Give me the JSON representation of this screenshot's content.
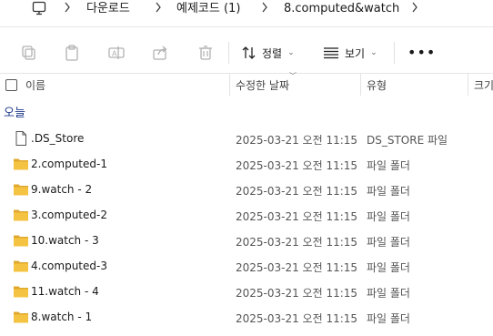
{
  "breadcrumb": {
    "items": [
      "다운로드",
      "예제코드 (1)",
      "8.computed&watch"
    ]
  },
  "toolbar": {
    "sort_label": "정렬",
    "view_label": "보기",
    "more_label": "•••"
  },
  "columns": {
    "name": "이름",
    "modified": "수정한 날짜",
    "type": "유형",
    "size": "크기"
  },
  "group": {
    "label": "오늘"
  },
  "files": [
    {
      "name": ".DS_Store",
      "modified": "2025-03-21 오전 11:15",
      "type": "DS_STORE 파일",
      "icon": "file-icon"
    },
    {
      "name": "2.computed-1",
      "modified": "2025-03-21 오전 11:15",
      "type": "파일 폴더",
      "icon": "folder-icon"
    },
    {
      "name": "9.watch - 2",
      "modified": "2025-03-21 오전 11:15",
      "type": "파일 폴더",
      "icon": "folder-icon"
    },
    {
      "name": "3.computed-2",
      "modified": "2025-03-21 오전 11:15",
      "type": "파일 폴더",
      "icon": "folder-icon"
    },
    {
      "name": "10.watch - 3",
      "modified": "2025-03-21 오전 11:15",
      "type": "파일 폴더",
      "icon": "folder-icon"
    },
    {
      "name": "4.computed-3",
      "modified": "2025-03-21 오전 11:15",
      "type": "파일 폴더",
      "icon": "folder-icon"
    },
    {
      "name": "11.watch - 4",
      "modified": "2025-03-21 오전 11:15",
      "type": "파일 폴더",
      "icon": "folder-icon"
    },
    {
      "name": "8.watch - 1",
      "modified": "2025-03-21 오전 11:15",
      "type": "파일 폴더",
      "icon": "folder-icon"
    }
  ],
  "colors": {
    "folder": "#F5C342",
    "folder_dark": "#E0A82E",
    "group_label": "#1E3A8A"
  }
}
